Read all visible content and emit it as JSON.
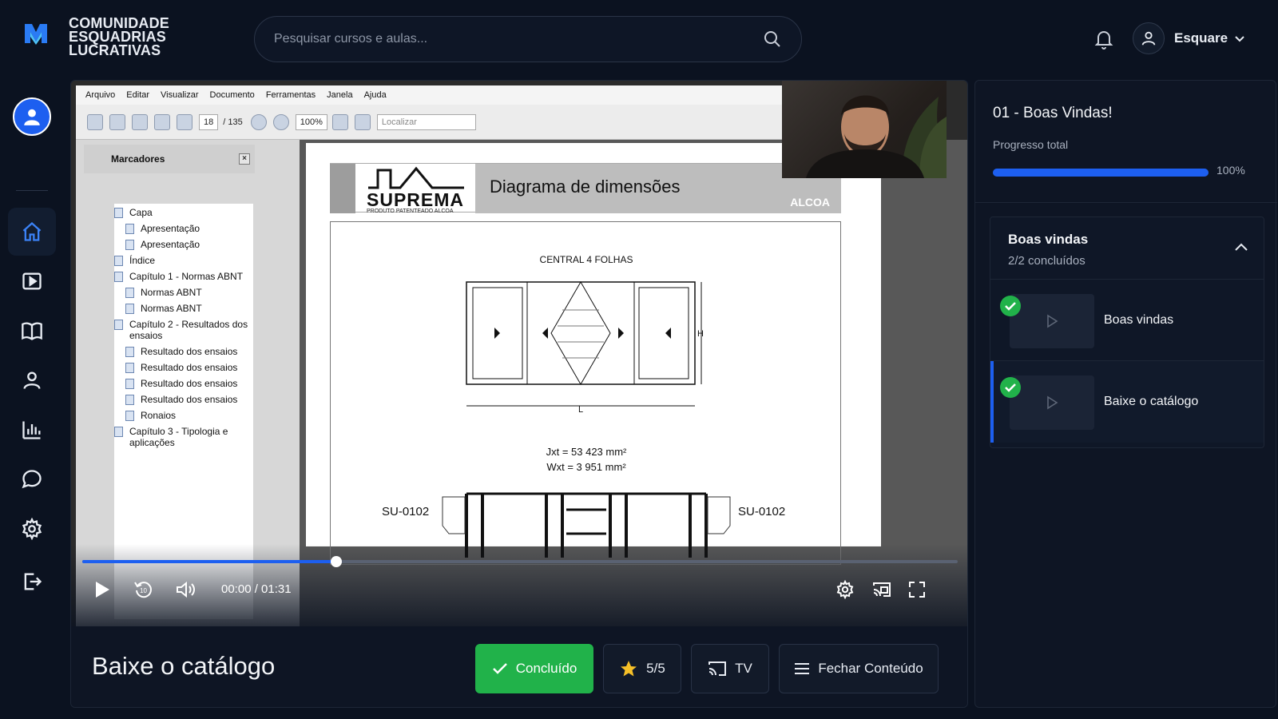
{
  "brand": {
    "lines": [
      "COMUNIDADE",
      "ESQUADRIAS",
      "LUCRATIVAS"
    ]
  },
  "search": {
    "placeholder": "Pesquisar cursos e aulas..."
  },
  "user": {
    "name": "Esquare"
  },
  "colors": {
    "accent": "#1d5ff0",
    "success": "#21b24a",
    "background": "#0b1220"
  },
  "sidebar": {
    "items": [
      {
        "icon": "home-icon",
        "active": true
      },
      {
        "icon": "play-square-icon",
        "active": false
      },
      {
        "icon": "book-icon",
        "active": false
      },
      {
        "icon": "user-icon",
        "active": false
      },
      {
        "icon": "chart-icon",
        "active": false
      },
      {
        "icon": "chat-icon",
        "active": false
      },
      {
        "icon": "gear-icon",
        "active": false
      },
      {
        "icon": "logout-icon",
        "active": false
      }
    ]
  },
  "pdf": {
    "menu": [
      "Arquivo",
      "Editar",
      "Visualizar",
      "Documento",
      "Ferramentas",
      "Janela",
      "Ajuda"
    ],
    "page_current": "18",
    "page_total": "/ 135",
    "zoom": "100%",
    "find_placeholder": "Localizar",
    "bookmarks_title": "Marcadores",
    "bookmarks_close": "×",
    "bookmarks": [
      "Capa",
      "Apresentação",
      "Apresentação",
      "Índice",
      "Capítulo 1 - Normas ABNT",
      "Normas ABNT",
      "Normas ABNT",
      "Capítulo 2 - Resultados dos ensaios",
      "Resultado dos ensaios",
      "Resultado dos ensaios",
      "Resultado dos ensaios",
      "Resultado dos ensaios",
      "Ronaios",
      "Capítulo 3 - Tipologia e aplicações"
    ],
    "page": {
      "brand": "SUPREMA",
      "brand_sub": "PRODUTO PATENTEADO ALCOA",
      "title": "Diagrama de dimensões",
      "partner": "ALCOA",
      "caption": "CENTRAL 4 FOLHAS",
      "dim_h": "H",
      "dim_l": "L",
      "jxt": "Jxt = 53 423 mm²",
      "wxt": "Wxt = 3 951 mm²",
      "profile_left": "SU-0102",
      "profile_right": "SU-0102"
    }
  },
  "player": {
    "progress": 0.29,
    "time": "00:00 / 01:31"
  },
  "lesson": {
    "title": "Baixe o catálogo",
    "done_label": "Concluído",
    "rating_label": "5/5",
    "tv_label": "TV",
    "close_label": "Fechar Conteúdo"
  },
  "course": {
    "title": "01 - Boas Vindas!",
    "progress_label": "Progresso total",
    "progress_value": 1.0,
    "progress_text": "100%",
    "module": {
      "title": "Boas vindas",
      "count": "2/2 concluídos",
      "lessons": [
        {
          "name": "Boas vindas",
          "done": true,
          "active": false
        },
        {
          "name": "Baixe o catálogo",
          "done": true,
          "active": true
        }
      ]
    }
  }
}
